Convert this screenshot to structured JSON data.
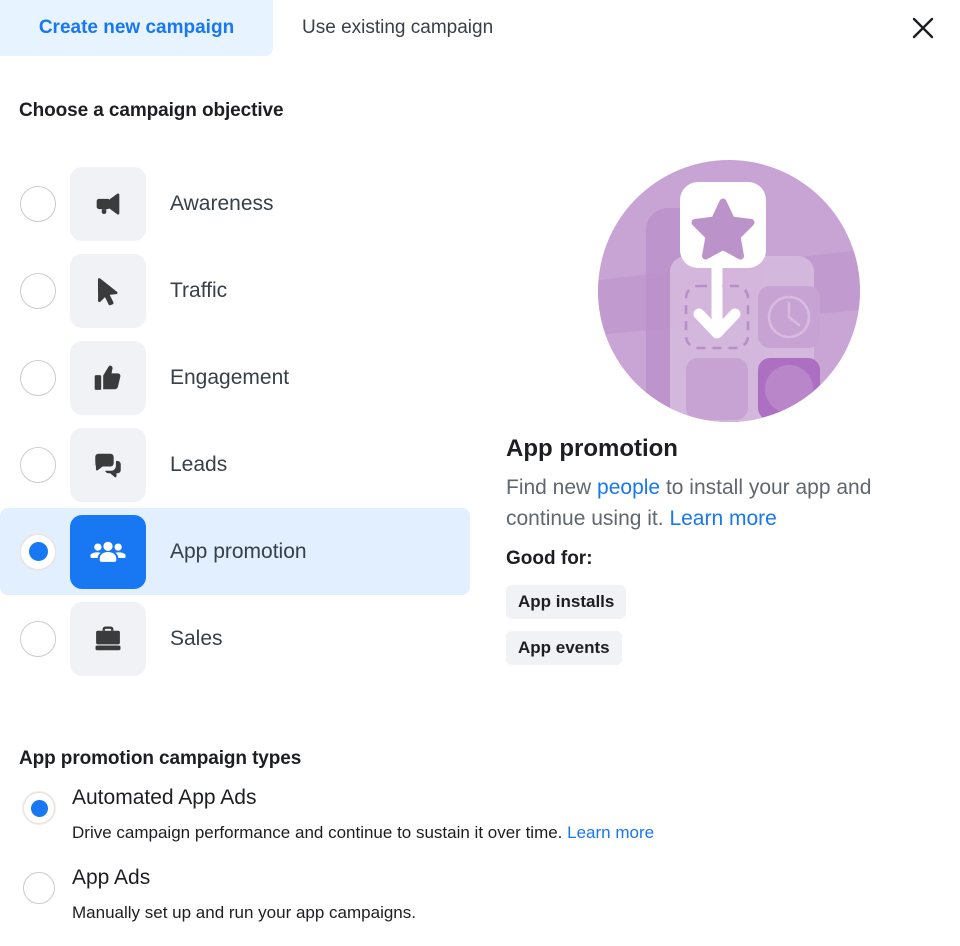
{
  "tabs": [
    {
      "label": "Create new campaign",
      "selected": true,
      "name": "tab-create-new-campaign"
    },
    {
      "label": "Use existing campaign",
      "selected": false,
      "name": "tab-use-existing-campaign"
    }
  ],
  "close_icon": "close-icon",
  "objective_section": {
    "title": "Choose a campaign objective",
    "items": [
      {
        "label": "Awareness",
        "icon": "megaphone-icon",
        "selected": false
      },
      {
        "label": "Traffic",
        "icon": "cursor-arrow-icon",
        "selected": false
      },
      {
        "label": "Engagement",
        "icon": "thumbs-up-icon",
        "selected": false
      },
      {
        "label": "Leads",
        "icon": "speech-bubbles-icon",
        "selected": false
      },
      {
        "label": "App promotion",
        "icon": "people-group-icon",
        "selected": true
      },
      {
        "label": "Sales",
        "icon": "briefcase-icon",
        "selected": false
      }
    ]
  },
  "detail": {
    "illustration": "app-install-illustration",
    "title": "App promotion",
    "description_part1": "Find new ",
    "description_link1": "people",
    "description_part2": " to install your app and continue using it. ",
    "description_link2": "Learn more",
    "good_for_label": "Good for:",
    "chips": [
      "App installs",
      "App events"
    ]
  },
  "campaign_types_section": {
    "title": "App promotion campaign types",
    "options": [
      {
        "label": "Automated App Ads",
        "description": "Drive campaign performance and continue to sustain it over time. ",
        "link": "Learn more",
        "selected": true
      },
      {
        "label": "App Ads",
        "description": "Manually set up and run your app campaigns.",
        "link": "",
        "selected": false
      }
    ]
  },
  "colors": {
    "accent_blue": "#1877f2",
    "tab_active_bg": "#e7f3ff",
    "row_selected_bg": "#e2efff",
    "tile_bg": "#f0f2f5",
    "illustration_purple": "#c49fd0"
  }
}
